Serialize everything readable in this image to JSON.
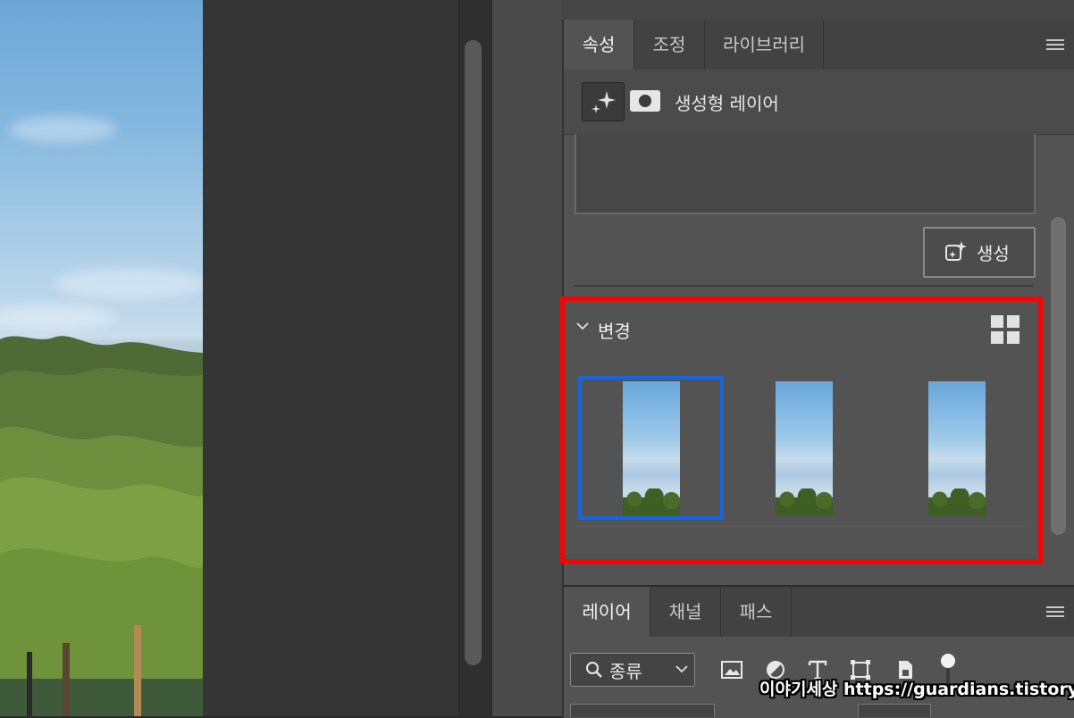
{
  "properties_panel": {
    "tabs": [
      {
        "label": "속성",
        "active": true
      },
      {
        "label": "조정",
        "active": false
      },
      {
        "label": "라이브러리",
        "active": false
      }
    ],
    "layer_type_label": "생성형 레이어",
    "generate_button_label": "생성",
    "variations": {
      "title": "변경",
      "thumbnail_count": 3,
      "selected_index": 0
    }
  },
  "layers_panel": {
    "tabs": [
      {
        "label": "레이어",
        "active": true
      },
      {
        "label": "채널",
        "active": false
      },
      {
        "label": "패스",
        "active": false
      }
    ],
    "filter_label": "종류"
  },
  "watermark": "이야기세상 https://guardians.tistory.com",
  "colors": {
    "highlight_border": "#ff0000",
    "selection_border": "#1565e0",
    "panel_bg": "#535353"
  }
}
